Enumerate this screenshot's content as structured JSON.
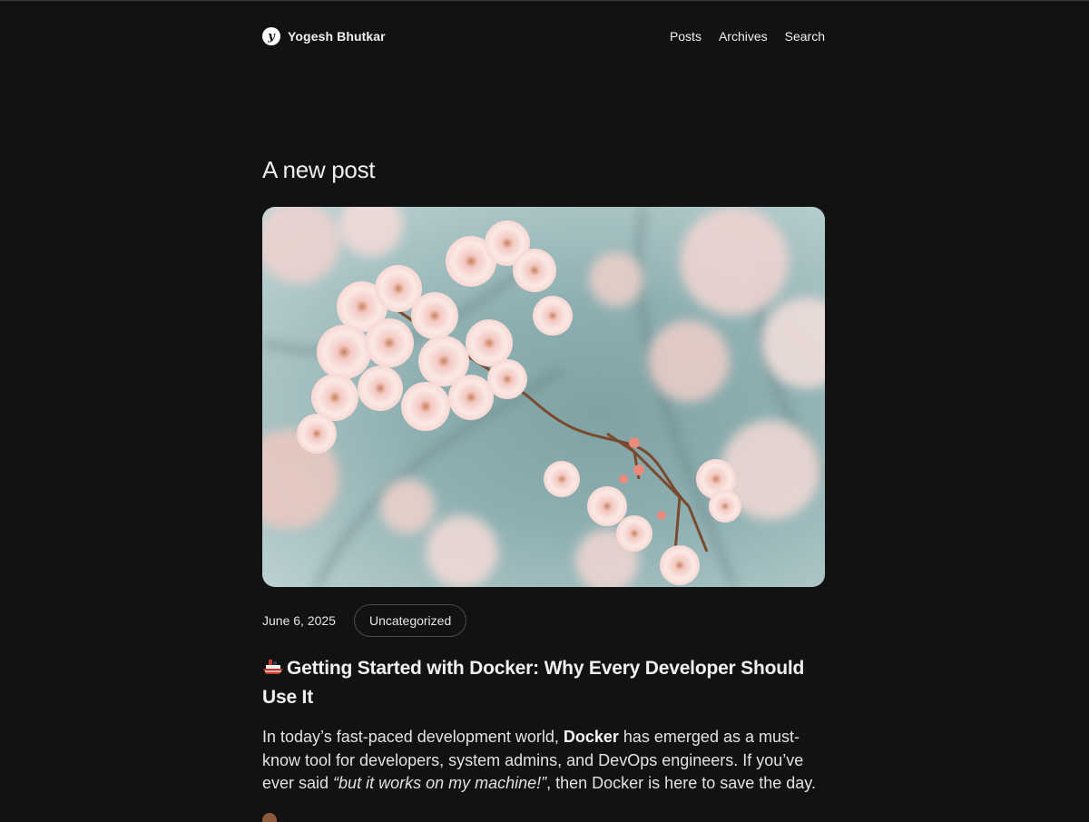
{
  "site": {
    "name": "Yogesh Bhutkar",
    "logo_letter": "y"
  },
  "nav": {
    "items": [
      "Posts",
      "Archives",
      "Search"
    ]
  },
  "page": {
    "heading": "A new post"
  },
  "post": {
    "image_alt": "Pink cherry blossoms on branches against a soft teal sky",
    "date": "June 6, 2025",
    "category": "Uncategorized",
    "title_icon": "ship-icon",
    "title": "Getting Started with Docker: Why Every Developer Should Use It",
    "excerpt": {
      "before": "In today’s fast-paced development world, ",
      "bold": "Docker",
      "middle": " has emerged as a must-know tool for developers, system admins, and DevOps engineers. If you’ve ever said ",
      "italic": "“but it works on my machine!”",
      "after": ", then Docker is here to save the day."
    }
  },
  "colors": {
    "background": "#121212",
    "text": "#e8e8e8",
    "chip_border": "#4a4a4a",
    "sky": "#8fb0b2",
    "blossom": "#f6dcd8"
  }
}
